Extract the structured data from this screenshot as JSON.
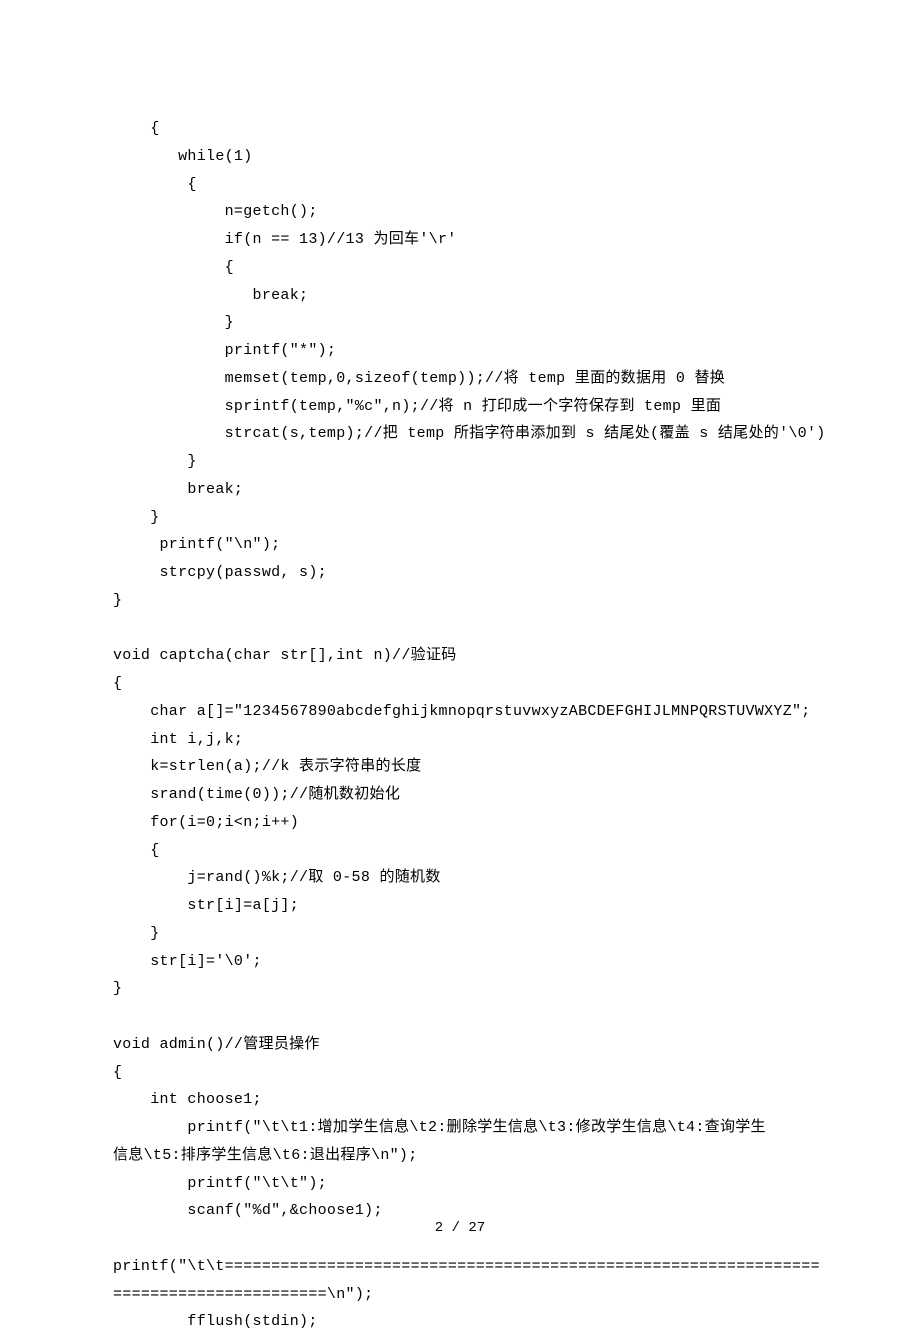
{
  "code": {
    "lines": [
      "    {",
      "       while(1)",
      "        {",
      "            n=getch();",
      "            if(n == 13)//13 为回车'\\r'",
      "            {",
      "               break;",
      "            }",
      "            printf(\"*\");",
      "            memset(temp,0,sizeof(temp));//将 temp 里面的数据用 0 替换",
      "            sprintf(temp,\"%c\",n);//将 n 打印成一个字符保存到 temp 里面",
      "            strcat(s,temp);//把 temp 所指字符串添加到 s 结尾处(覆盖 s 结尾处的'\\0')",
      "        }",
      "        break;",
      "    }",
      "     printf(\"\\n\");",
      "     strcpy(passwd, s);",
      "}",
      "",
      "void captcha(char str[],int n)//验证码",
      "{",
      "    char a[]=\"1234567890abcdefghijkmnopqrstuvwxyzABCDEFGHIJLMNPQRSTUVWXYZ\";",
      "    int i,j,k;",
      "    k=strlen(a);//k 表示字符串的长度",
      "    srand(time(0));//随机数初始化",
      "    for(i=0;i<n;i++)",
      "    {",
      "        j=rand()%k;//取 0-58 的随机数",
      "        str[i]=a[j];",
      "    }",
      "    str[i]='\\0';",
      "}",
      "",
      "void admin()//管理员操作",
      "{",
      "    int choose1;",
      "        printf(\"\\t\\t1:增加学生信息\\t2:删除学生信息\\t3:修改学生信息\\t4:查询学生",
      "信息\\t5:排序学生信息\\t6:退出程序\\n\");",
      "        printf(\"\\t\\t\");",
      "        scanf(\"%d\",&choose1);",
      "",
      "printf(\"\\t\\t================================================================",
      "=======================\\n\");",
      "        fflush(stdin);"
    ]
  },
  "footer": {
    "page": "2 / 27"
  }
}
